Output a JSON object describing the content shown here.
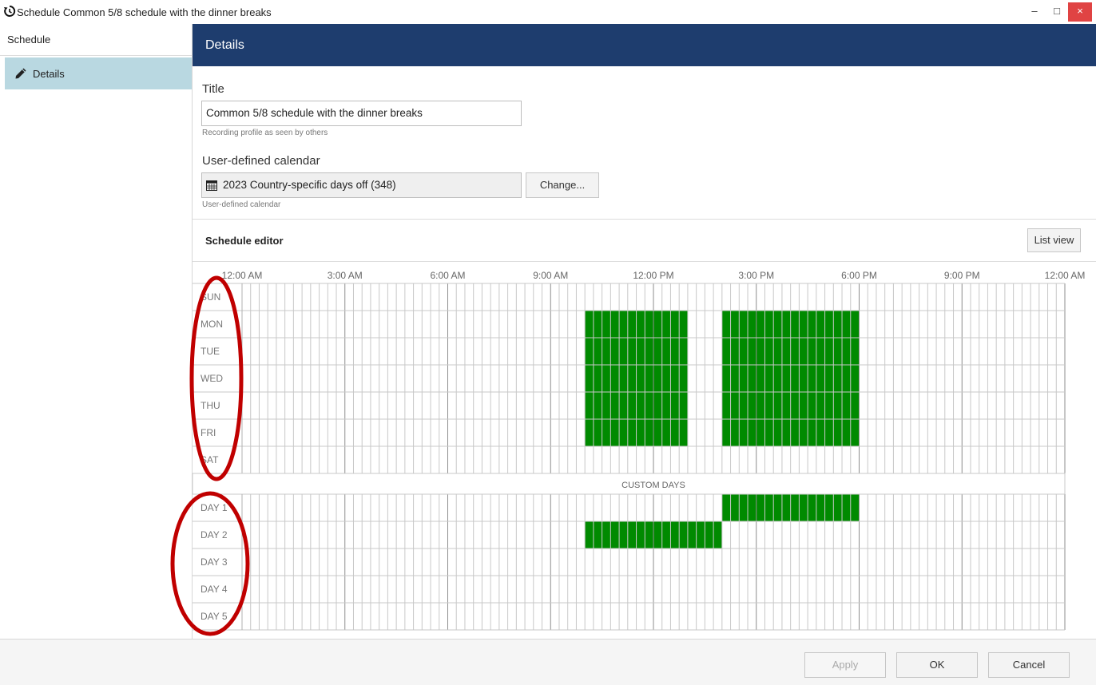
{
  "window": {
    "title": "Schedule Common 5/8 schedule with the dinner breaks",
    "minimize": "–",
    "maximize": "□",
    "close": "×",
    "icon": "schedule-app-icon"
  },
  "sidebar": {
    "header": "Schedule",
    "items": [
      {
        "label": "Details",
        "icon": "pencil-icon",
        "selected": true
      }
    ]
  },
  "details": {
    "header": "Details",
    "title_label": "Title",
    "title_value": "Common 5/8 schedule with the dinner breaks",
    "title_hint": "Recording profile as seen by others",
    "calendar_label": "User-defined calendar",
    "calendar_value": "2023 Country-specific days off (348)",
    "calendar_icon": "calendar-icon",
    "change_button": "Change...",
    "calendar_hint": "User-defined calendar"
  },
  "schedule_editor": {
    "title": "Schedule editor",
    "list_view_button": "List view",
    "time_labels": [
      "12:00 AM",
      "3:00 AM",
      "6:00 AM",
      "9:00 AM",
      "12:00 PM",
      "3:00 PM",
      "6:00 PM",
      "9:00 PM",
      "12:00 AM"
    ],
    "slot_minutes": 15,
    "week_days": [
      "SUN",
      "MON",
      "TUE",
      "WED",
      "THU",
      "FRI",
      "SAT"
    ],
    "custom_days_label": "CUSTOM DAYS",
    "custom_days": [
      "DAY 1",
      "DAY 2",
      "DAY 3",
      "DAY 4",
      "DAY 5"
    ],
    "active_color": "#008a00",
    "week_active": {
      "SUN": [],
      "MON": [
        [
          "10:00",
          "13:00"
        ],
        [
          "14:00",
          "18:00"
        ]
      ],
      "TUE": [
        [
          "10:00",
          "13:00"
        ],
        [
          "14:00",
          "18:00"
        ]
      ],
      "WED": [
        [
          "10:00",
          "13:00"
        ],
        [
          "14:00",
          "18:00"
        ]
      ],
      "THU": [
        [
          "10:00",
          "13:00"
        ],
        [
          "14:00",
          "18:00"
        ]
      ],
      "FRI": [
        [
          "10:00",
          "13:00"
        ],
        [
          "14:00",
          "18:00"
        ]
      ],
      "SAT": []
    },
    "custom_active": {
      "DAY 1": [
        [
          "14:00",
          "18:00"
        ]
      ],
      "DAY 2": [
        [
          "10:00",
          "14:00"
        ]
      ],
      "DAY 3": [],
      "DAY 4": [],
      "DAY 5": []
    }
  },
  "footer": {
    "apply": "Apply",
    "ok": "OK",
    "cancel": "Cancel"
  },
  "annotation_color": "#c00000"
}
